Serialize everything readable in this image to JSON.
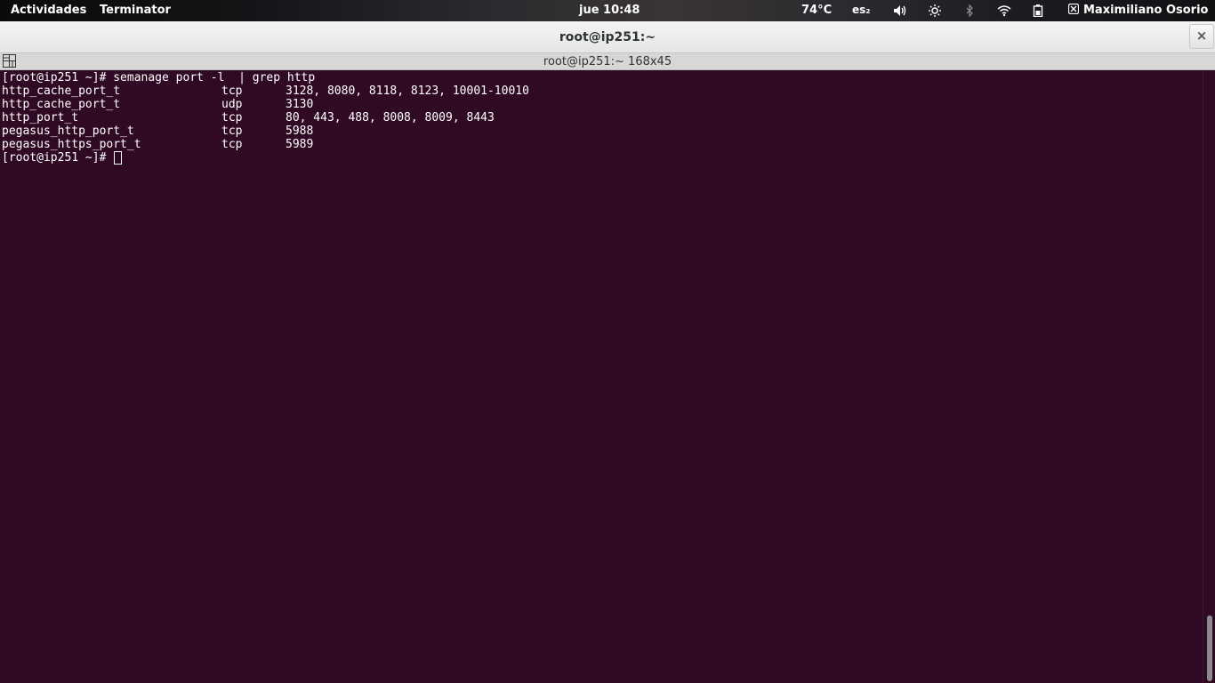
{
  "topbar": {
    "activities": "Actividades",
    "app_name": "Terminator",
    "clock": "jue 10:48",
    "temperature": "74°C",
    "keyboard_layout": "es₂",
    "user": "Maximiliano Osorio",
    "icons": [
      "volume-icon",
      "brightness-icon",
      "bluetooth-icon",
      "wifi-icon",
      "battery-icon",
      "user-icon"
    ]
  },
  "window": {
    "title": "root@ip251:~",
    "close_label": "×"
  },
  "terminal": {
    "header_title": "root@ip251:~ 168x45",
    "command_line": "[root@ip251 ~]# semanage port -l  | grep http",
    "rows": [
      {
        "type": "http_cache_port_t",
        "proto": "tcp",
        "ports": "3128, 8080, 8118, 8123, 10001-10010"
      },
      {
        "type": "http_cache_port_t",
        "proto": "udp",
        "ports": "3130"
      },
      {
        "type": "http_port_t",
        "proto": "tcp",
        "ports": "80, 443, 488, 8008, 8009, 8443"
      },
      {
        "type": "pegasus_http_port_t",
        "proto": "tcp",
        "ports": "5988"
      },
      {
        "type": "pegasus_https_port_t",
        "proto": "tcp",
        "ports": "5989"
      }
    ],
    "prompt": "[root@ip251 ~]# "
  },
  "colors": {
    "terminal_bg": "#300a24",
    "terminal_fg": "#ffffff",
    "titlebar_bg": "#ececec"
  }
}
